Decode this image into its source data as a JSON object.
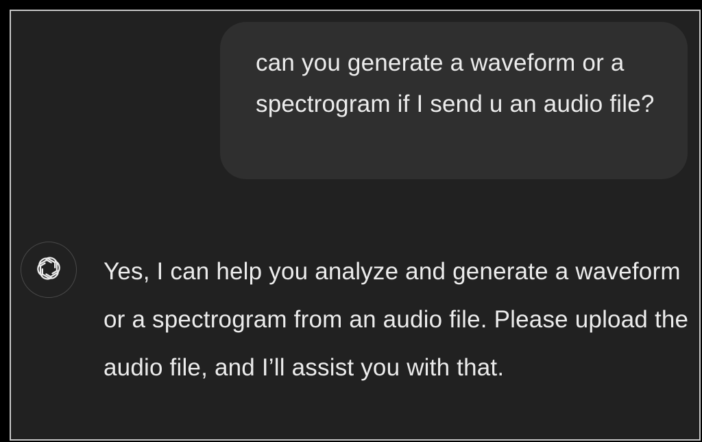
{
  "conversation": {
    "user_message": "can you generate a waveform or a spectrogram if I send u an audio file?",
    "assistant_message": "Yes, I can help you analyze and generate a waveform or a spectrogram from an audio file. Please upload the audio file, and I’ll assist you with that.",
    "assistant_avatar_icon": "openai-logo-icon"
  },
  "colors": {
    "background": "#212121",
    "user_bubble": "#2f2f2f",
    "text": "#ececec",
    "border": "#c9c9c9"
  }
}
